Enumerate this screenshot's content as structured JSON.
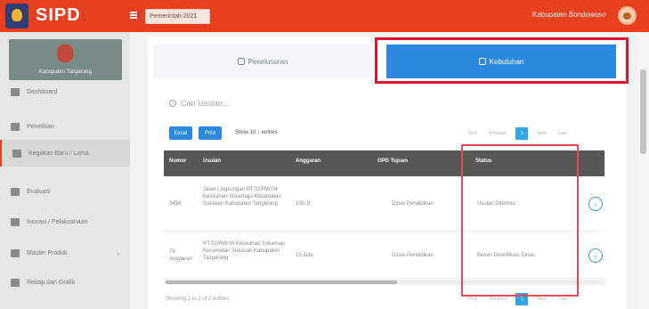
{
  "header": {
    "app_title": "SIPD",
    "year_selector": "Pemerintah 2021",
    "region_name": "Kabupaten Bondowoso"
  },
  "sidebar": {
    "profile_name": "Kabupaten Tangerang",
    "items": [
      {
        "label": "Dashboard",
        "icon": "dashboard-icon"
      },
      {
        "label": "Penelitian",
        "icon": "research-icon"
      },
      {
        "label": "Kegiatan Baru / Lama",
        "icon": "activity-icon"
      },
      {
        "label": "Evaluasi",
        "icon": "evaluation-icon"
      },
      {
        "label": "Inovasi / Pelaksanaan",
        "icon": "innovation-icon"
      },
      {
        "label": "Master Produk",
        "icon": "product-icon"
      },
      {
        "label": "Rekap dan Grafik",
        "icon": "chart-icon"
      }
    ]
  },
  "tabs": [
    {
      "label": "Penelusuran",
      "icon": "document-icon"
    },
    {
      "label": "Kebutuhan",
      "icon": "tag-icon"
    }
  ],
  "search": {
    "placeholder": "Cari Usulan..."
  },
  "toolbar": {
    "button_1": "Excel",
    "button_2": "Print",
    "show_entries": "Show 10 ↕ entries"
  },
  "pagination": [
    "First",
    "Previous",
    "1",
    "Next",
    "Last"
  ],
  "table": {
    "columns": [
      "Nomor",
      "Usulan",
      "Anggaran",
      "OPD Tujuan",
      "Status",
      ""
    ],
    "rows": [
      {
        "nomor": "3456",
        "usulan": "Jalan Lingkungan RT.02/RW.04 Kelurahan Sukamaju Kecamatan Sukasari Kabupaten Tangerang",
        "anggaran": "100 Jt",
        "opd": "Dinas Pendidikan",
        "status": "Usulan Diterima"
      },
      {
        "nomor": "78 Anggaran",
        "usulan": "RT.02/RW.04 Kelurahan Sukamaju Kecamatan Sukasari Kabupaten Tangerang",
        "anggaran": "15 Juta",
        "opd": "Dinas Pendidikan",
        "status": "Belum Diverifikasi Dinas"
      }
    ]
  },
  "footer": {
    "info": "Showing 1 to 2 of 2 entries"
  },
  "colors": {
    "header": "#e8401e",
    "primary": "#2c89e0",
    "highlight": "#e3122b",
    "table_head": "#565656"
  }
}
